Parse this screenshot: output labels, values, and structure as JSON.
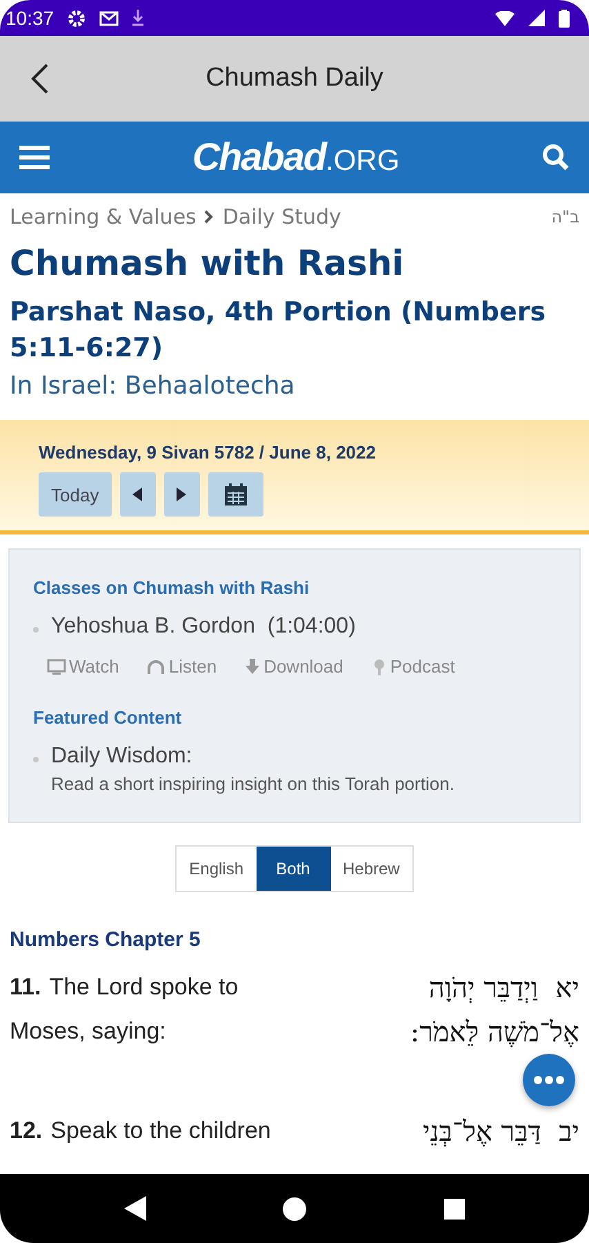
{
  "status_bar": {
    "time": "10:37"
  },
  "app_bar": {
    "title": "Chumash Daily"
  },
  "site_header": {
    "logo_main": "Chabad",
    "logo_suffix": ".ORG"
  },
  "breadcrumb": [
    "Learning & Values",
    "Daily Study"
  ],
  "bh_mark": "ב\"ה",
  "title": "Chumash with Rashi",
  "subtitle": "Parshat Naso, 4th Portion (Numbers 5:11-6:27)",
  "israel_note": "In Israel: Behaalotecha",
  "date_bar": {
    "date": "Wednesday, 9 Sivan 5782 / June 8, 2022",
    "today_button": "Today"
  },
  "classes": {
    "heading": "Classes on Chumash with Rashi",
    "speaker": "Yehoshua B. Gordon",
    "duration": "(1:04:00)",
    "media": [
      {
        "kind": "watch",
        "label": "Watch"
      },
      {
        "kind": "listen",
        "label": "Listen"
      },
      {
        "kind": "download",
        "label": "Download"
      },
      {
        "kind": "podcast",
        "label": "Podcast"
      }
    ]
  },
  "featured": {
    "heading": "Featured Content",
    "title": "Daily Wisdom:",
    "description": "Read a short inspiring insight on this Torah portion."
  },
  "language_toggle": [
    {
      "label": "English",
      "selected": false
    },
    {
      "label": "Both",
      "selected": true
    },
    {
      "label": "Hebrew",
      "selected": false
    }
  ],
  "chapter_heading": "Numbers Chapter 5",
  "verses": [
    {
      "number": "11.",
      "english": "The Lord spoke to Moses, saying:",
      "hebrew_number": "יא",
      "hebrew": "וַיְדַבֵּר יְהֹוָה אֶל־מֹשֶׁה לֵּאמֹר:"
    },
    {
      "number": "12.",
      "english": "Speak to the children",
      "hebrew_number": "יב",
      "hebrew": "דַּבֵּר אֶל־בְּנֵי"
    }
  ]
}
